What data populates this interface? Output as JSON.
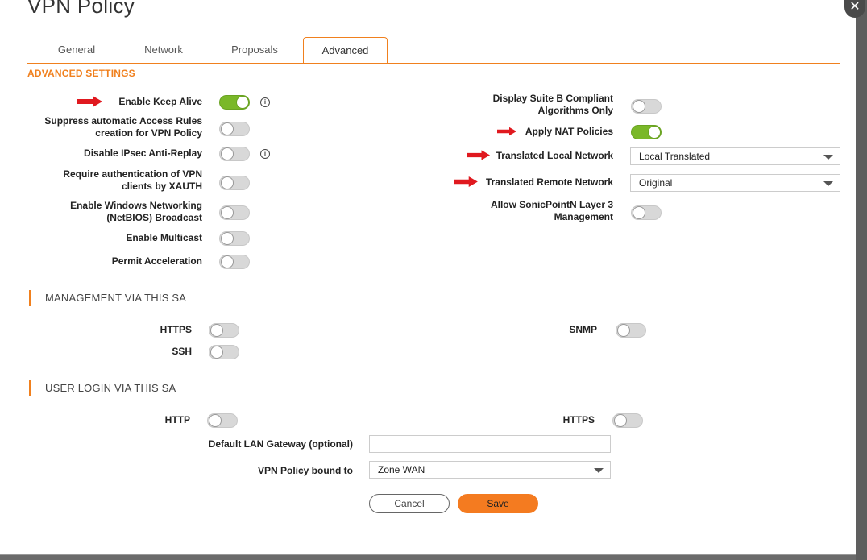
{
  "dialog": {
    "title": "VPN Policy",
    "close_icon": "close-icon"
  },
  "tabs": [
    {
      "label": "General",
      "active": false
    },
    {
      "label": "Network",
      "active": false
    },
    {
      "label": "Proposals",
      "active": false
    },
    {
      "label": "Advanced",
      "active": true
    }
  ],
  "advanced": {
    "heading": "ADVANCED SETTINGS",
    "left": [
      {
        "label": "Enable Keep Alive",
        "on": true
      },
      {
        "label": "Suppress automatic Access Rules creation for VPN Policy",
        "on": false
      },
      {
        "label": "Disable IPsec Anti-Replay",
        "on": false
      },
      {
        "label": "Require authentication of VPN clients by XAUTH",
        "on": false
      },
      {
        "label": "Enable Windows Networking (NetBIOS) Broadcast",
        "on": false
      },
      {
        "label": "Enable Multicast",
        "on": false
      },
      {
        "label": "Permit Acceleration",
        "on": false
      }
    ],
    "right": {
      "suite_b": {
        "label": "Display Suite B Compliant Algorithms Only",
        "on": false
      },
      "apply_nat": {
        "label": "Apply NAT Policies",
        "on": true
      },
      "translated_local": {
        "label": "Translated Local Network",
        "value": "Local Translated"
      },
      "translated_remote": {
        "label": "Translated Remote Network",
        "value": "Original"
      },
      "sonicpoint": {
        "label": "Allow SonicPointN Layer 3 Management",
        "on": false
      }
    }
  },
  "management": {
    "heading": "MANAGEMENT VIA THIS SA",
    "https": {
      "label": "HTTPS",
      "on": false
    },
    "ssh": {
      "label": "SSH",
      "on": false
    },
    "snmp": {
      "label": "SNMP",
      "on": false
    }
  },
  "user_login": {
    "heading": "USER LOGIN VIA THIS SA",
    "http": {
      "label": "HTTP",
      "on": false
    },
    "https": {
      "label": "HTTPS",
      "on": false
    },
    "gateway_label": "Default LAN Gateway (optional)",
    "gateway_value": "",
    "bound_label": "VPN Policy bound to",
    "bound_value": "Zone WAN"
  },
  "buttons": {
    "cancel": "Cancel",
    "save": "Save"
  },
  "colors": {
    "accent": "#f0801e",
    "toggle_on": "#7ab829",
    "arrow": "#e0191f"
  }
}
